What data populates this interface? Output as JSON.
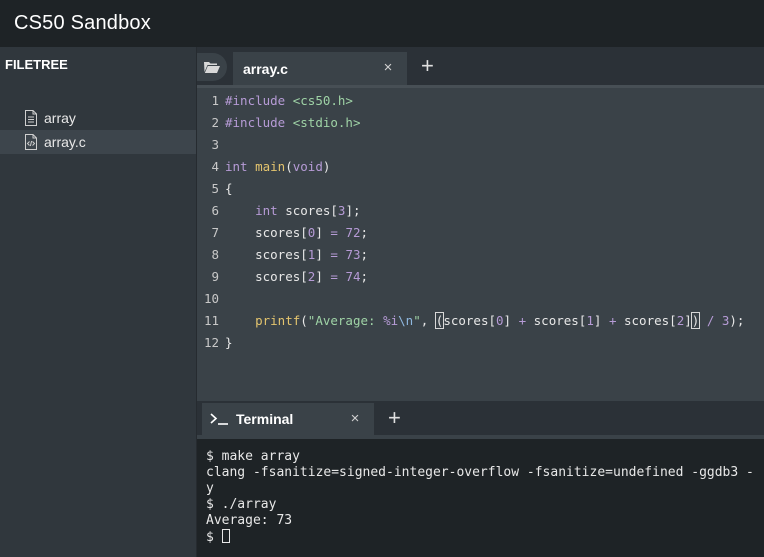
{
  "app": {
    "title": "CS50 Sandbox"
  },
  "sidebar": {
    "heading": "FILETREE",
    "items": [
      {
        "label": "array",
        "icon": "file-icon"
      },
      {
        "label": "array.c",
        "icon": "code-file-icon",
        "selected": true
      }
    ]
  },
  "editor_tabs": [
    {
      "label": "array.c",
      "close": "×"
    }
  ],
  "add_tab": "+",
  "editor": {
    "line_numbers": [
      "1",
      "2",
      "3",
      "4",
      "5",
      "6",
      "7",
      "8",
      "9",
      "10",
      "11",
      "12"
    ]
  },
  "terminal_tab": {
    "label": "Terminal",
    "close": "×",
    "prompt_icon": "terminal-prompt-icon"
  },
  "terminal": {
    "lines": [
      "$ make array",
      "clang -fsanitize=signed-integer-overflow -fsanitize=undefined -ggdb3 -",
      "y",
      "$ ./array",
      "Average: 73",
      "$ "
    ]
  },
  "colors": {
    "titlebar": "#1e2326",
    "sidebar": "#30373d",
    "editor_bg": "#3a4248",
    "terminal_bg": "#1e2326",
    "keyword": "#b69bd6",
    "string": "#9fd3a6",
    "function": "#e3c46e"
  }
}
